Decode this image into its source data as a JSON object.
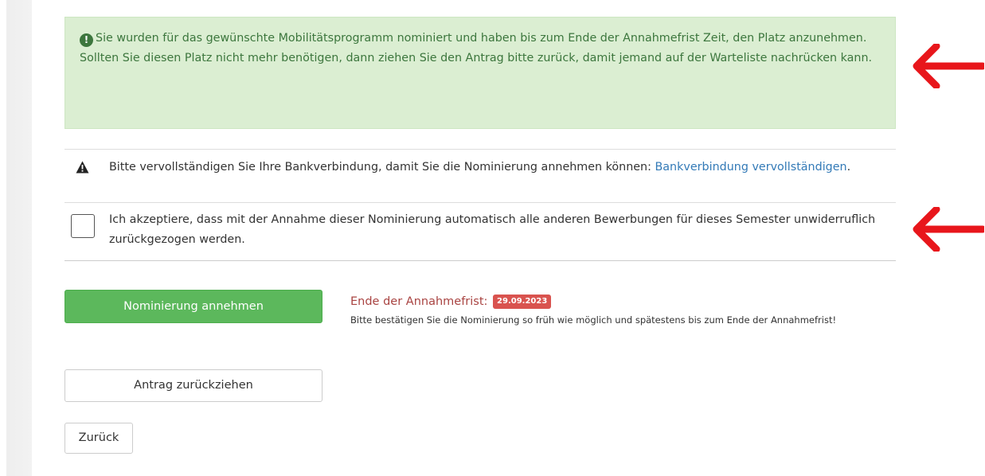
{
  "alert": {
    "line1": "Sie wurden für das gewünschte Mobilitätsprogramm nominiert und haben bis zum Ende der Annahmefrist Zeit, den Platz anzunehmen.",
    "line2": "Sollten Sie diesen Platz nicht mehr benötigen, dann ziehen Sie den Antrag bitte zurück, damit jemand auf der Warteliste nachrücken kann.",
    "icon": "exclamation-circle-icon",
    "color": "#3c763d",
    "background": "#dbeed2"
  },
  "bank": {
    "text": "Bitte vervollständigen Sie Ihre Bankverbindung, damit Sie die Nominierung annehmen können: ",
    "link_text": "Bankverbindung vervollständigen",
    "suffix": ".",
    "icon": "warning-triangle-icon"
  },
  "acceptance": {
    "checked": false,
    "text": "Ich akzeptiere, dass mit der Annahme dieser Nominierung automatisch alle anderen Bewerbungen für dieses Semester unwiderruflich zurückgezogen werden."
  },
  "actions": {
    "accept_label": "Nominierung annehmen",
    "withdraw_label": "Antrag zurückziehen",
    "back_label": "Zurück"
  },
  "deadline": {
    "title": "Ende der Annahmefrist:",
    "date": "29.09.2023",
    "note": "Bitte bestätigen Sie die Nominierung so früh wie möglich und spätestens bis zum Ende der Annahmefrist!"
  },
  "annotations": {
    "arrow_color": "#e8161b",
    "arrow_icon": "red-left-arrow-icon"
  },
  "colors": {
    "success_button": "#5cb85c",
    "danger_badge": "#d9534f",
    "link": "#337ab7"
  }
}
